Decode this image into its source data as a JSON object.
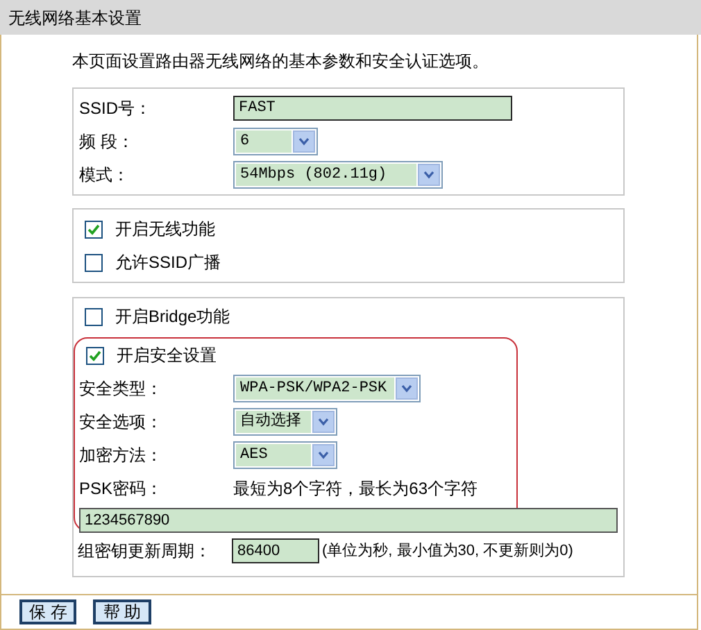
{
  "header": {
    "title": "无线网络基本设置"
  },
  "intro": "本页面设置路由器无线网络的基本参数和安全认证选项。",
  "basic": [
    {
      "label": "SSID号：",
      "kind": "text",
      "value": "FAST"
    },
    {
      "label": "频 段：",
      "kind": "select",
      "value": "6"
    },
    {
      "label": "模式：",
      "kind": "select",
      "value": "54Mbps (802.11g)"
    }
  ],
  "toggles": [
    {
      "label": "开启无线功能",
      "checked": true
    },
    {
      "label": "允许SSID广播",
      "checked": false
    }
  ],
  "bridge": {
    "label": "开启Bridge功能",
    "checked": false
  },
  "security": {
    "highlighted": true,
    "enable": {
      "label": "开启安全设置",
      "checked": true
    },
    "fields": [
      {
        "label": "安全类型：",
        "value": "WPA-PSK/WPA2-PSK"
      },
      {
        "label": "安全选项：",
        "value": "自动选择"
      },
      {
        "label": "加密方法：",
        "value": "AES"
      }
    ],
    "psk": {
      "label": "PSK密码：",
      "hint": "最短为8个字符，最长为63个字符",
      "value": "1234567890"
    }
  },
  "group_key": {
    "label": "组密钥更新周期：",
    "value": "86400",
    "note": "(单位为秒, 最小值为30, 不更新则为0)"
  },
  "buttons": [
    "保 存",
    "帮 助"
  ]
}
